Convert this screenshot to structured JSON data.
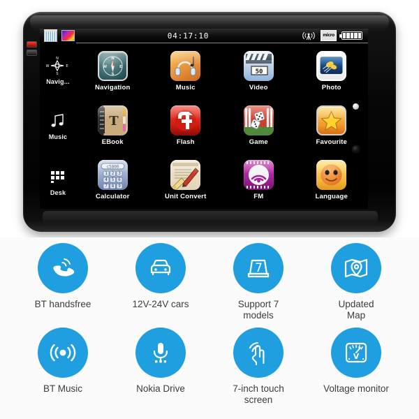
{
  "device": {
    "statusbar": {
      "calendar_icon": "calendar-icon",
      "gradient_icon": "gradient-thumbnail-icon",
      "time": "04:17:10",
      "signal_icon": "signal-antenna-icon",
      "sd_icon_label": "micro",
      "battery_icon": "battery-full-icon",
      "battery_cells": 5
    },
    "sidebar": [
      {
        "label": "Navig...",
        "icon": "compass-rose-icon"
      },
      {
        "label": "Music",
        "icon": "music-note-icon"
      },
      {
        "label": "Desk",
        "icon": "desktop-grid-icon"
      }
    ],
    "apps": [
      {
        "label": "Navigation",
        "icon": "compass-icon",
        "style": "ic-nav"
      },
      {
        "label": "Music",
        "icon": "headphones-icon",
        "style": "ic-music"
      },
      {
        "label": "Video",
        "icon": "clapperboard-icon",
        "style": "ic-video"
      },
      {
        "label": "Photo",
        "icon": "photo-icon",
        "style": "ic-photo"
      },
      {
        "label": "EBook",
        "icon": "book-icon",
        "style": "ic-ebook"
      },
      {
        "label": "Flash",
        "icon": "flash-logo-icon",
        "style": "ic-flash"
      },
      {
        "label": "Game",
        "icon": "dice-icon",
        "style": "ic-game"
      },
      {
        "label": "Favourite",
        "icon": "star-icon",
        "style": "ic-fav"
      },
      {
        "label": "Calculator",
        "icon": "calculator-icon",
        "style": "ic-calc"
      },
      {
        "label": "Unit Convert",
        "icon": "ruler-pencil-icon",
        "style": "ic-unit"
      },
      {
        "label": "FM",
        "icon": "radio-waves-icon",
        "style": "ic-fm"
      },
      {
        "label": "Language",
        "icon": "smiley-face-icon",
        "style": "ic-lang"
      }
    ],
    "video_icon_number": "50",
    "calculator_display": "c5800",
    "calculator_keys": [
      "1",
      "2",
      "3",
      "4",
      "5",
      "6",
      "7",
      "8",
      "9"
    ],
    "ebook_letter": "T",
    "indicator_dots": [
      "power-led-dot",
      "light-sensor-dot"
    ]
  },
  "features": [
    {
      "label": "BT handsfree",
      "icon": "phone-handset-icon"
    },
    {
      "label": "12V-24V cars",
      "icon": "car-icon"
    },
    {
      "label": "Support 7\nmodels",
      "icon": "box-seven-icon"
    },
    {
      "label": "Updated\nMap",
      "icon": "map-pin-icon"
    },
    {
      "label": "BT Music",
      "icon": "bluetooth-audio-waves-icon"
    },
    {
      "label": "Nokia Drive",
      "icon": "microphone-icon"
    },
    {
      "label": "7-inch touch\nscreen",
      "icon": "touch-gesture-icon"
    },
    {
      "label": "Voltage monitor",
      "icon": "voltmeter-gauge-icon"
    }
  ],
  "colors": {
    "accent_blue": "#1f9fe0",
    "background": "#fbfbfb",
    "label_text": "#3d3d3d",
    "screen_black": "#000000"
  }
}
